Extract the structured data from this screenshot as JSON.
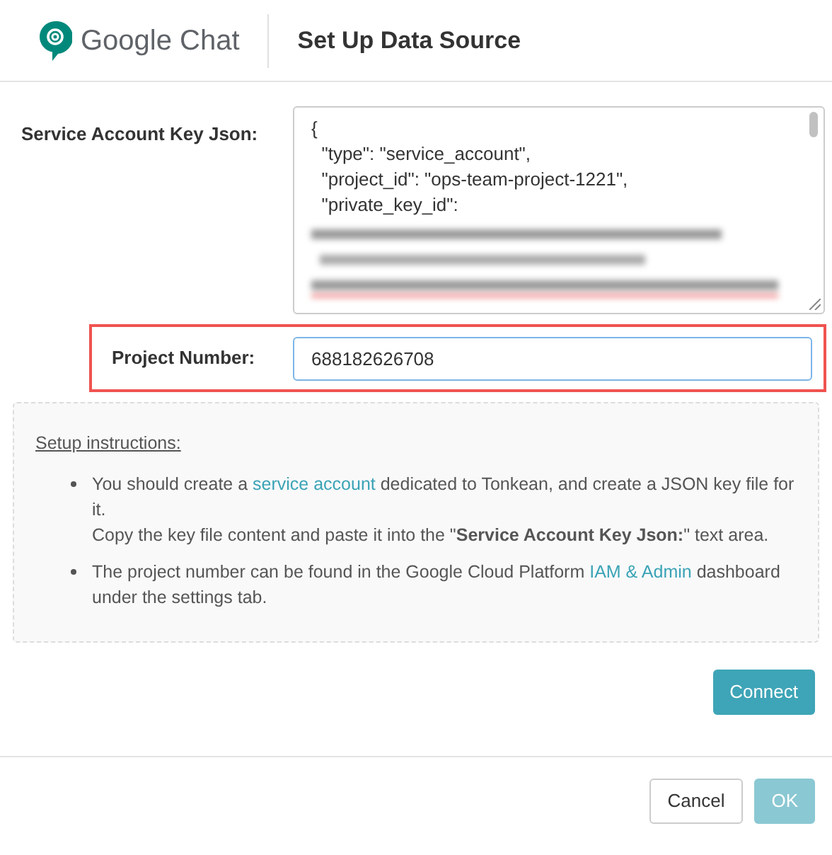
{
  "header": {
    "app_name": "Google Chat",
    "title": "Set Up Data Source"
  },
  "key_json": {
    "label": "Service Account Key Json:",
    "lines": [
      "{",
      "  \"type\": \"service_account\",",
      "  \"project_id\": \"ops-team-project-1221\",",
      "  \"private_key_id\":"
    ]
  },
  "project_number": {
    "label": "Project Number:",
    "value": "688182626708",
    "highlighted": true
  },
  "instructions": {
    "heading": "Setup instructions:",
    "items": [
      {
        "paragraphs": [
          [
            {
              "kind": "text",
              "text": "You should create a "
            },
            {
              "kind": "link",
              "text": "service account"
            },
            {
              "kind": "text",
              "text": " dedicated to Tonkean, and create a JSON key file for it."
            }
          ],
          [
            {
              "kind": "text",
              "text": "Copy the key file content and paste it into the \"**Service Account Key Json:**\" text area."
            }
          ]
        ]
      },
      {
        "paragraphs": [
          [
            {
              "kind": "text",
              "text": "The project number can be found in the Google Cloud Platform "
            },
            {
              "kind": "link",
              "text": "IAM & Admin"
            },
            {
              "kind": "text",
              "text": " dashboard under the settings tab."
            }
          ]
        ]
      }
    ]
  },
  "connect_button": {
    "label": "Connect"
  },
  "footer_buttons": [
    {
      "kind": "secondary",
      "label": "Cancel",
      "disabled": false
    },
    {
      "kind": "primary",
      "label": "OK",
      "disabled": true
    }
  ]
}
